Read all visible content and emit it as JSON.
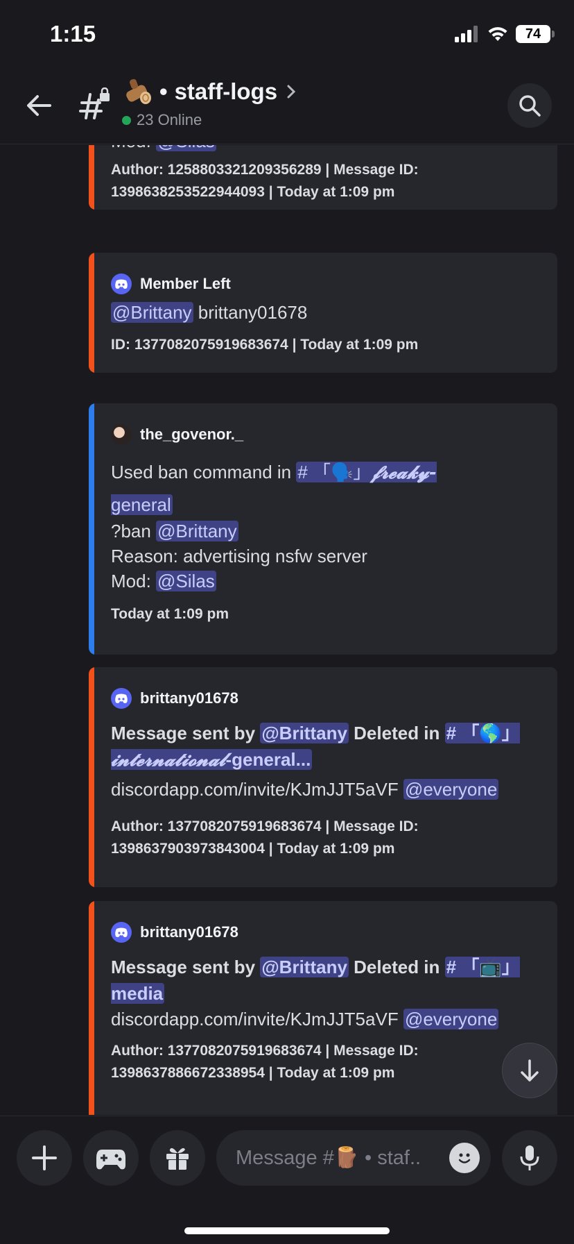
{
  "status": {
    "time": "1:15",
    "battery": "74"
  },
  "header": {
    "channel_name": "staff-logs",
    "separator": "•",
    "online": "23 Online",
    "log_emoji": "log-emoji"
  },
  "colors": {
    "accent": "#5865f2",
    "orange_bar": "#f2511b",
    "blue_bar": "#2d7ded",
    "online": "#23a55a",
    "mention_bg": "#3f4385"
  },
  "embeds": [
    {
      "mod_label": "Mod:",
      "mod_mention": "@Silas",
      "footer_line1": "Author: 1258803321209356289 | Message ID:",
      "footer_line2": "1398638253522944093 | Today at 1:09 pm"
    },
    {
      "author": "Member Left",
      "mention": "@Brittany",
      "username": "brittany01678",
      "footer": "ID: 1377082075919683674 | Today at 1:09 pm"
    },
    {
      "author": "the_govenor._",
      "line1_text": "Used ban command in",
      "channel_mention_prefix": "# 「🗣️」",
      "channel_mention_script": "𝓯𝓻𝓮𝓪𝓴𝔂-",
      "channel_mention_rest": "general",
      "ban_text": "?ban",
      "ban_mention": "@Brittany",
      "reason": "Reason: advertising nsfw server",
      "mod_label": "Mod:",
      "mod_mention": "@Silas",
      "footer": "Today at 1:09 pm"
    },
    {
      "author": "brittany01678",
      "sent_by": "Message sent by",
      "mention": "@Brittany",
      "deleted_in": "Deleted in",
      "channel_prefix": "# 「🌎」",
      "channel_script": "𝓲𝓷𝓽𝓮𝓻𝓷𝓪𝓽𝓲𝓸𝓷𝓪𝓵",
      "channel_rest": "-general...",
      "link": "discordapp.com/invite/KJmJJT5aVF",
      "everyone": "@everyone",
      "footer_line1": "Author: 1377082075919683674 | Message ID:",
      "footer_line2": "1398637903973843004 | Today at 1:09 pm"
    },
    {
      "author": "brittany01678",
      "sent_by": "Message sent by",
      "mention": "@Brittany",
      "deleted_in": "Deleted in",
      "channel_prefix": "# 「📺」",
      "channel_rest": "media",
      "link": "discordapp.com/invite/KJmJJT5aVF",
      "everyone": "@everyone",
      "footer_line1": "Author: 1377082075919683674 | Message ID:",
      "footer_line2": "1398637886672338954 | Today at 1:09 pm"
    }
  ],
  "composer": {
    "placeholder": "Message #🪵 • staf.."
  }
}
